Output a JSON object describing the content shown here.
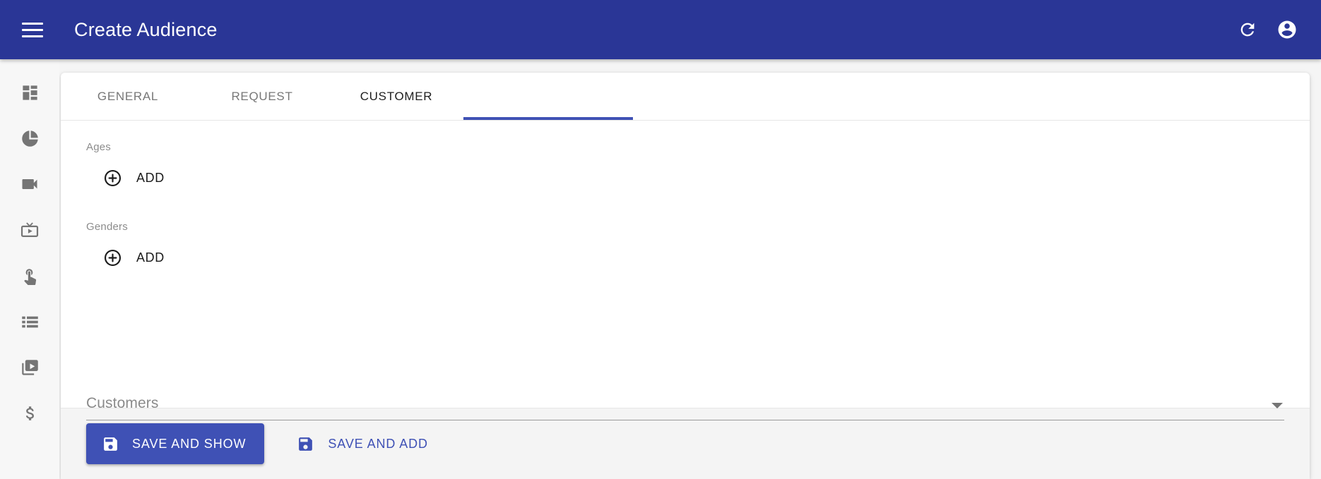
{
  "appbar": {
    "menu_icon": "hamburger-menu-icon",
    "title": "Create Audience",
    "refresh_icon": "refresh-icon",
    "account_icon": "account-circle-icon",
    "background_color": "#2a3696"
  },
  "sidebar": {
    "items": [
      {
        "icon": "dashboard-icon",
        "name": "dashboard"
      },
      {
        "icon": "pie-chart-icon",
        "name": "reports"
      },
      {
        "icon": "videocam-icon",
        "name": "videocam"
      },
      {
        "icon": "live-tv-icon",
        "name": "live-tv"
      },
      {
        "icon": "touch-app-icon",
        "name": "touch-app"
      },
      {
        "icon": "list-icon",
        "name": "list"
      },
      {
        "icon": "video-library-icon",
        "name": "video-library"
      },
      {
        "icon": "dollar-icon",
        "name": "billing"
      }
    ]
  },
  "tabs": {
    "items": [
      {
        "label": "GENERAL",
        "active": false
      },
      {
        "label": "REQUEST",
        "active": false
      },
      {
        "label": "CUSTOMER",
        "active": true
      }
    ],
    "indicator_color": "#3f51b5"
  },
  "form": {
    "ages": {
      "label": "Ages",
      "add_label": "ADD",
      "add_icon": "add-circle-outline-icon"
    },
    "genders": {
      "label": "Genders",
      "add_label": "ADD",
      "add_icon": "add-circle-outline-icon"
    },
    "customers": {
      "label": "Customers",
      "value": "",
      "arrow_icon": "dropdown-arrow-icon"
    }
  },
  "footer": {
    "primary": {
      "label": "SAVE AND SHOW",
      "icon": "save-icon",
      "color": "#3f51b5"
    },
    "secondary": {
      "label": "SAVE AND ADD",
      "icon": "save-icon",
      "color": "#3f51b5"
    }
  }
}
